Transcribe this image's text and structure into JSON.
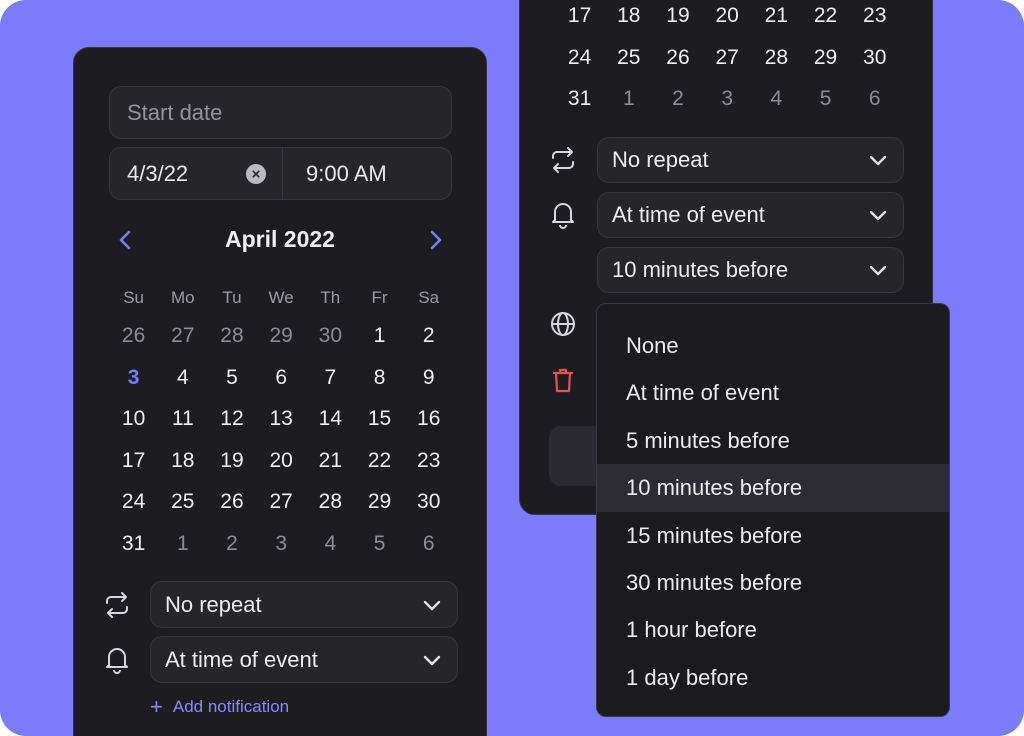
{
  "left_panel": {
    "start_date_placeholder": "Start date",
    "date_value": "4/3/22",
    "time_value": "9:00 AM",
    "month_title": "April 2022",
    "weekdays": [
      "Su",
      "Mo",
      "Tu",
      "We",
      "Th",
      "Fr",
      "Sa"
    ],
    "weeks": [
      [
        "26",
        "27",
        "28",
        "29",
        "30",
        "1",
        "2"
      ],
      [
        "3",
        "4",
        "5",
        "6",
        "7",
        "8",
        "9"
      ],
      [
        "10",
        "11",
        "12",
        "13",
        "14",
        "15",
        "16"
      ],
      [
        "17",
        "18",
        "19",
        "20",
        "21",
        "22",
        "23"
      ],
      [
        "24",
        "25",
        "26",
        "27",
        "28",
        "29",
        "30"
      ],
      [
        "31",
        "1",
        "2",
        "3",
        "4",
        "5",
        "6"
      ]
    ],
    "selected_day": "3",
    "repeat_value": "No repeat",
    "notification_value": "At time of event",
    "add_notification_label": "Add notification"
  },
  "right_panel": {
    "weeks": [
      [
        "17",
        "18",
        "19",
        "20",
        "21",
        "22",
        "23"
      ],
      [
        "24",
        "25",
        "26",
        "27",
        "28",
        "29",
        "30"
      ],
      [
        "31",
        "1",
        "2",
        "3",
        "4",
        "5",
        "6"
      ]
    ],
    "repeat_value": "No repeat",
    "notification_value": "At time of event",
    "second_notification_value": "10 minutes before"
  },
  "dropdown": {
    "options": [
      "None",
      "At time of event",
      "5 minutes before",
      "10 minutes before",
      "15 minutes before",
      "30 minutes before",
      "1 hour before",
      "1 day before"
    ],
    "selected": "10 minutes before"
  },
  "colors": {
    "background": "#7b7bfc",
    "panel": "#1d1d21",
    "accent": "#7b7bfc",
    "delete": "#e5534b"
  },
  "icons": {
    "repeat": "repeat-icon",
    "bell": "bell-icon",
    "globe": "globe-icon",
    "trash": "trash-icon",
    "chevron": "chevron-down-icon",
    "clear": "clear-icon",
    "prev": "chevron-left-icon",
    "next": "chevron-right-icon"
  }
}
